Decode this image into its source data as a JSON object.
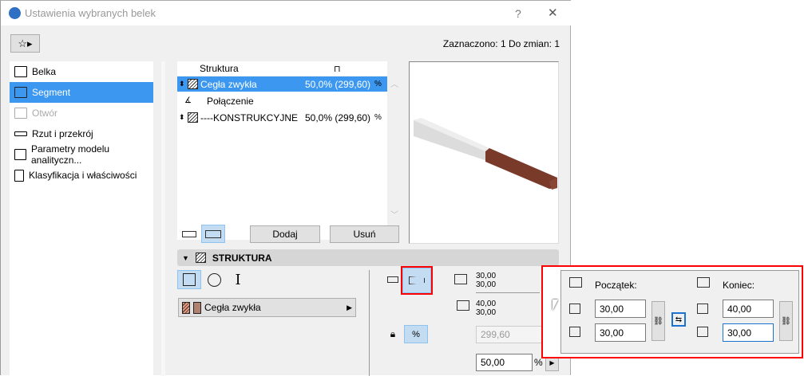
{
  "window": {
    "title": "Ustawienia wybranych belek",
    "help": "?",
    "close": "✕"
  },
  "header": {
    "selection_status": "Zaznaczono: 1 Do zmian: 1"
  },
  "sidebar": {
    "items": [
      {
        "label": "Belka"
      },
      {
        "label": "Segment",
        "selected": true
      },
      {
        "label": "Otwór",
        "disabled": true
      },
      {
        "label": "Rzut i przekrój"
      },
      {
        "label": "Parametry modelu analityczn..."
      },
      {
        "label": "Klasyfikacja i właściwości"
      }
    ]
  },
  "segments_table": {
    "header": "Struktura",
    "rows": [
      {
        "name": "Cegła zwykła",
        "value": "50,0% (299,60)",
        "selected": true
      },
      {
        "name": "Połączenie",
        "connector": true
      },
      {
        "name": "----KONSTRUKCYJNE",
        "value": "50,0% (299,60)"
      }
    ]
  },
  "buttons": {
    "add": "Dodaj",
    "remove": "Usuń"
  },
  "structure": {
    "title": "STRUKTURA",
    "material": "Cegła zwykła",
    "start_w": "30,00",
    "start_h": "30,00",
    "end_w": "40,00",
    "end_h": "30,00",
    "length": "299,60",
    "percent": "50,00",
    "percent_unit": "%",
    "percent_icon": "%"
  },
  "popup": {
    "start_label": "Początek:",
    "end_label": "Koniec:",
    "start_height": "30,00",
    "start_width": "30,00",
    "end_height": "40,00",
    "end_width": "30,00"
  },
  "colors": {
    "accent": "#3c97f0",
    "highlight": "#ff0000",
    "brick": "#7a3a2a"
  }
}
